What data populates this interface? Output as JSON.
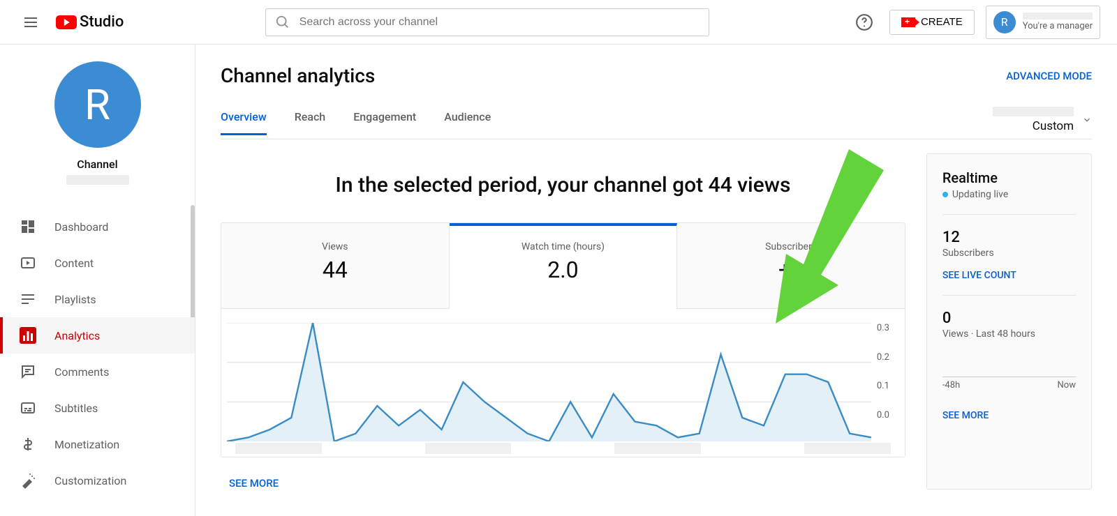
{
  "header": {
    "logo_text": "Studio",
    "search_placeholder": "Search across your channel",
    "create_label": "CREATE",
    "account_subtext": "You're a manager",
    "avatar_initial": "R"
  },
  "sidebar": {
    "avatar_initial": "R",
    "channel_label": "Channel",
    "items": [
      {
        "label": "Dashboard",
        "icon": "dashboard"
      },
      {
        "label": "Content",
        "icon": "content"
      },
      {
        "label": "Playlists",
        "icon": "playlists"
      },
      {
        "label": "Analytics",
        "icon": "analytics",
        "active": true
      },
      {
        "label": "Comments",
        "icon": "comments"
      },
      {
        "label": "Subtitles",
        "icon": "subtitles"
      },
      {
        "label": "Monetization",
        "icon": "monetization"
      },
      {
        "label": "Customization",
        "icon": "customization"
      }
    ]
  },
  "page": {
    "title": "Channel analytics",
    "advanced_mode": "ADVANCED MODE",
    "tabs": [
      "Overview",
      "Reach",
      "Engagement",
      "Audience"
    ],
    "active_tab": 0,
    "date_label": "Custom",
    "headline": "In the selected period, your channel got 44 views"
  },
  "metrics": [
    {
      "label": "Views",
      "value": "44"
    },
    {
      "label": "Watch time (hours)",
      "value": "2.0",
      "active": true
    },
    {
      "label": "Subscribers",
      "value": "+1"
    }
  ],
  "chart_data": {
    "type": "area",
    "ylabel": "Watch time (hours)",
    "ylim": [
      0,
      0.3
    ],
    "y_ticks": [
      "0.3",
      "0.2",
      "0.1",
      "0.0"
    ],
    "x_span_days": 28,
    "values": [
      0.0,
      0.01,
      0.03,
      0.06,
      0.3,
      0.0,
      0.02,
      0.09,
      0.04,
      0.08,
      0.03,
      0.15,
      0.1,
      0.06,
      0.02,
      0.0,
      0.1,
      0.01,
      0.12,
      0.05,
      0.04,
      0.01,
      0.02,
      0.22,
      0.06,
      0.04,
      0.17,
      0.17,
      0.15,
      0.02,
      0.01
    ]
  },
  "see_more": "SEE MORE",
  "realtime": {
    "title": "Realtime",
    "updating": "Updating live",
    "subscribers_value": "12",
    "subscribers_label": "Subscribers",
    "live_count_link": "SEE LIVE COUNT",
    "views_value": "0",
    "views_label": "Views · Last 48 hours",
    "x_start": "-48h",
    "x_end": "Now",
    "see_more": "SEE MORE"
  }
}
